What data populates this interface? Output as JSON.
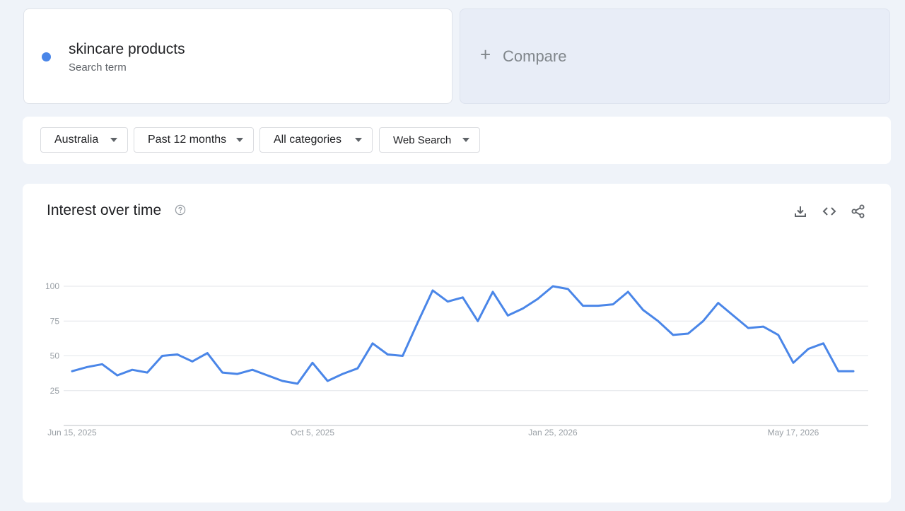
{
  "search_term": {
    "name": "skincare products",
    "type_label": "Search term",
    "color": "#4a86e8"
  },
  "compare": {
    "label": "Compare",
    "icon": "plus-icon"
  },
  "filters": {
    "region": "Australia",
    "time_range": "Past 12 months",
    "category": "All categories",
    "property": "Web Search"
  },
  "chart_card": {
    "title": "Interest over time",
    "help_icon": "help-circle-icon",
    "tools": [
      "download-icon",
      "embed-code-icon",
      "share-icon"
    ]
  },
  "chart_data": {
    "type": "line",
    "title": "Interest over time",
    "xlabel": "",
    "ylabel": "",
    "ylim": [
      0,
      100
    ],
    "yticks": [
      25,
      50,
      75,
      100
    ],
    "x_tick_labels": [
      {
        "label": "Jun 15, 2025",
        "index": 0
      },
      {
        "label": "Oct 5, 2025",
        "index": 16
      },
      {
        "label": "Jan 25, 2026",
        "index": 32
      },
      {
        "label": "May 17, 2026",
        "index": 48
      }
    ],
    "grid": true,
    "series": [
      {
        "color": "#4a86e8",
        "values": [
          39,
          42,
          44,
          36,
          40,
          38,
          50,
          51,
          46,
          52,
          38,
          37,
          40,
          36,
          32,
          30,
          45,
          32,
          37,
          41,
          59,
          51,
          50,
          74,
          97,
          89,
          92,
          75,
          96,
          79,
          84,
          91,
          100,
          98,
          86,
          86,
          87,
          96,
          83,
          75,
          65,
          66,
          75,
          88,
          79,
          70,
          71,
          65,
          45,
          55,
          59,
          39,
          39
        ]
      }
    ]
  }
}
